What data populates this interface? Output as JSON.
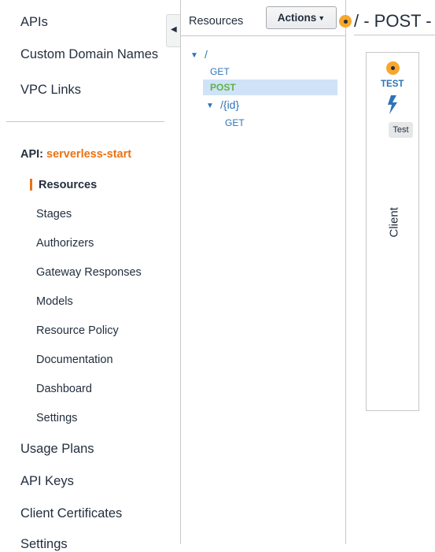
{
  "nav": {
    "top_items": [
      "APIs",
      "Custom Domain Names",
      "VPC Links"
    ],
    "api_prefix": "API:",
    "api_name": "serverless-start",
    "sub_items": [
      "Resources",
      "Stages",
      "Authorizers",
      "Gateway Responses",
      "Models",
      "Resource Policy",
      "Documentation",
      "Dashboard",
      "Settings"
    ],
    "bottom_items": [
      "Usage Plans",
      "API Keys",
      "Client Certificates",
      "Settings"
    ]
  },
  "resources": {
    "title": "Resources",
    "actions_label": "Actions",
    "tree": {
      "root_path": "/",
      "root_methods": [
        "GET",
        "POST"
      ],
      "child_path": "/{id}",
      "child_methods": [
        "GET"
      ]
    }
  },
  "method": {
    "title": "/ - POST -",
    "test_label": "TEST",
    "tooltip": "Test",
    "client_label": "Client"
  },
  "colors": {
    "accent_orange": "#ec7211",
    "link_blue": "#2e73b8",
    "post_green": "#5fb344",
    "selected_bg": "#cfe2f7"
  }
}
